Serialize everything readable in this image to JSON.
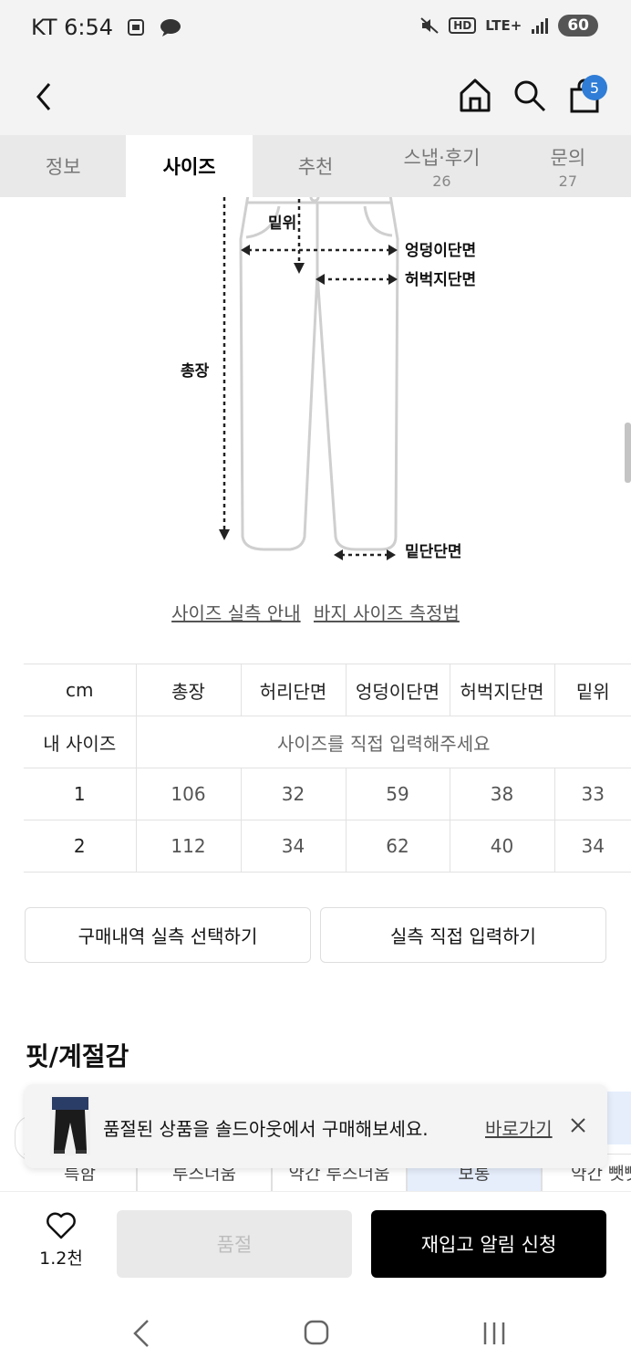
{
  "status_bar": {
    "carrier_time": "KT 6:54",
    "network": "LTE+",
    "battery": "60"
  },
  "app_bar": {
    "cart_count": "5"
  },
  "tabs": [
    {
      "label": "정보",
      "count": ""
    },
    {
      "label": "사이즈",
      "count": ""
    },
    {
      "label": "추천",
      "count": ""
    },
    {
      "label": "스냅·후기",
      "count": "26"
    },
    {
      "label": "문의",
      "count": "27"
    }
  ],
  "diagram": {
    "rise": "밑위",
    "hip": "엉덩이단면",
    "thigh": "허벅지단면",
    "length": "총장",
    "hem": "밑단단면"
  },
  "links": {
    "size_guide": "사이즈 실측 안내",
    "measure_guide": "바지 사이즈 측정법"
  },
  "size_table": {
    "headers": [
      "cm",
      "총장",
      "허리단면",
      "엉덩이단면",
      "허벅지단면",
      "밑위"
    ],
    "my_size_label": "내 사이즈",
    "my_size_hint": "사이즈를 직접 입력해주세요",
    "rows": [
      [
        "1",
        "106",
        "32",
        "59",
        "38",
        "33"
      ],
      [
        "2",
        "112",
        "34",
        "62",
        "40",
        "34"
      ]
    ]
  },
  "buttons": {
    "purchase_history": "구매내역 실측 선택하기",
    "direct_input": "실측 직접 입력하기"
  },
  "fit_section": {
    "title": "핏/계절감",
    "chips": [
      "특함",
      "루즈더움",
      "약간 루즈더움",
      "보통",
      "약간 뺏뺏"
    ]
  },
  "toast": {
    "message": "품절된 상품을 솔드아웃에서 구매해보세요.",
    "action": "바로가기"
  },
  "bottom_bar": {
    "like_count": "1.2천",
    "soldout_label": "품절",
    "restock_label": "재입고 알림 신청"
  },
  "colors": {
    "accent_badge": "#2f7dd6",
    "primary_button": "#000000"
  }
}
